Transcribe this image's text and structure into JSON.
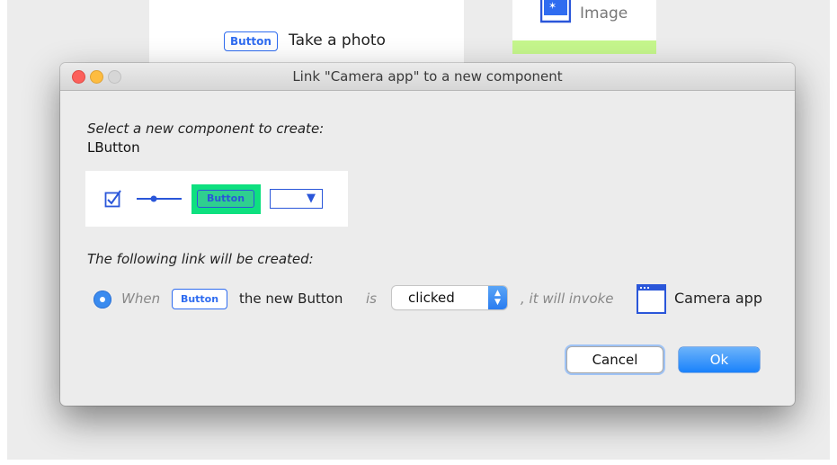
{
  "background": {
    "button_chip_label": "Button",
    "take_photo_label": "Take a photo",
    "image_label": "Image",
    "image_icon": "image-icon"
  },
  "dialog": {
    "title": "Link \"Camera app\" to a new component",
    "select_prompt": "Select a new component to create:",
    "selected_component": "LButton",
    "palette": {
      "items": [
        "checkbox-icon",
        "slider-icon",
        "button-icon",
        "dropdown-icon"
      ],
      "button_label": "Button",
      "selected_color": "#0ee07f"
    },
    "link_prompt": "The following link will be created:",
    "link": {
      "when": "When",
      "chip_label": "Button",
      "subject": "the new Button",
      "is": "is",
      "event_value": "clicked",
      "invoke": ", it will invoke",
      "target_icon": "window-icon",
      "target": "Camera app"
    },
    "buttons": {
      "cancel": "Cancel",
      "ok": "Ok"
    }
  },
  "colors": {
    "accent": "#2f6cf0",
    "radio": "#3a8bef",
    "ok_button": "#1a82fb"
  }
}
